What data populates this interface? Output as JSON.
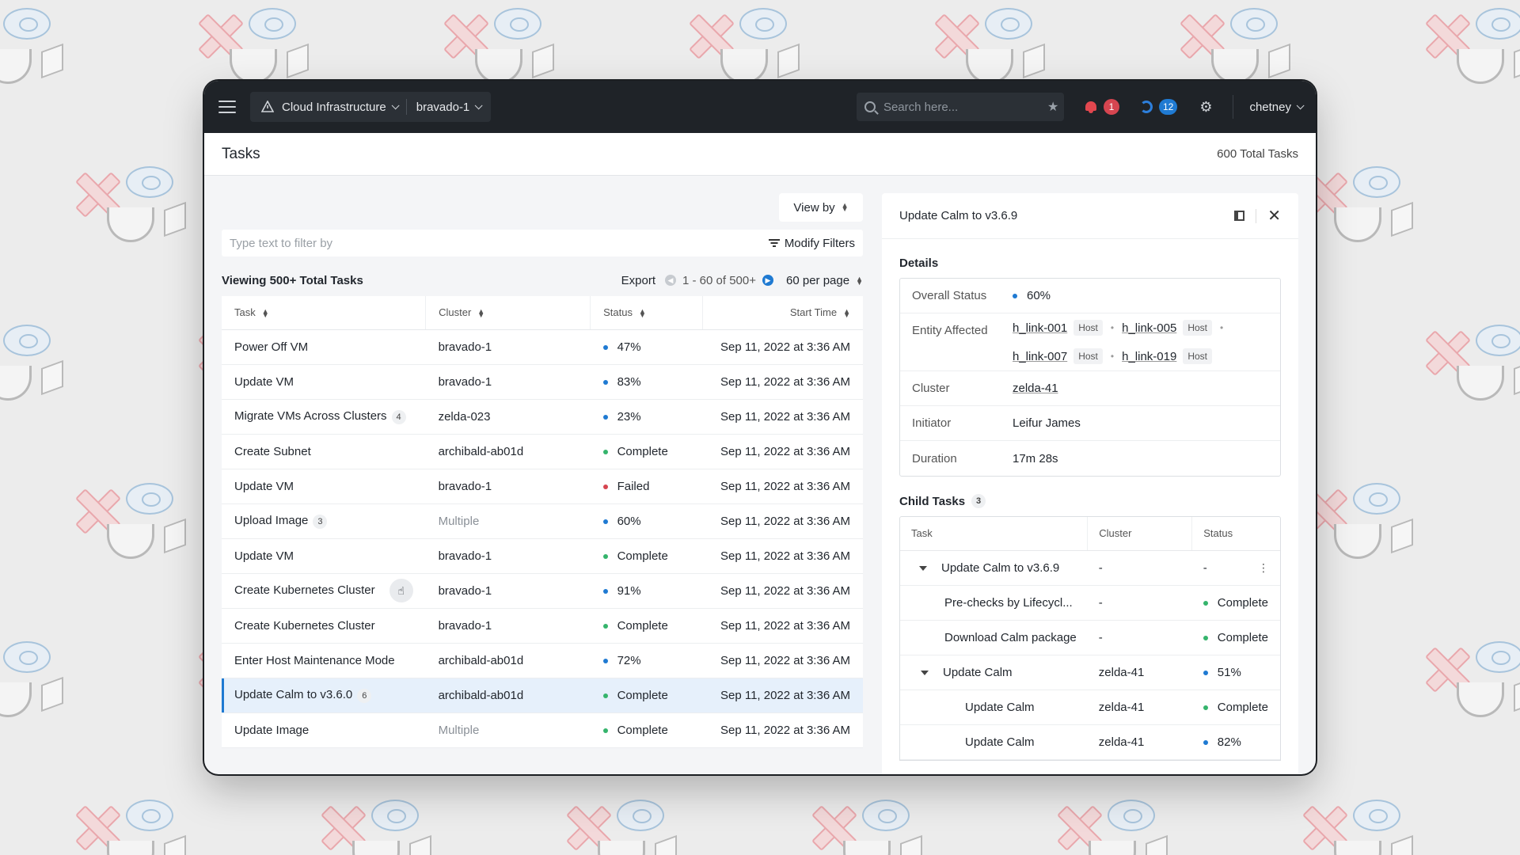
{
  "topbar": {
    "cluster_group": "Cloud Infrastructure",
    "cluster": "bravado-1",
    "search_placeholder": "Search here...",
    "alerts_count": "1",
    "tasks_count": "12",
    "user": "chetney"
  },
  "page": {
    "title": "Tasks",
    "total": "600 Total Tasks"
  },
  "list": {
    "view_by": "View by",
    "filter_placeholder": "Type text to filter by",
    "modify_filters": "Modify Filters",
    "viewing": "Viewing 500+ Total Tasks",
    "export": "Export",
    "range": "1 - 60 of 500+",
    "per_page": "60 per page",
    "columns": [
      "Task",
      "Cluster",
      "Status",
      "Start Time"
    ],
    "rows": [
      {
        "task": "Power Off VM",
        "count": "",
        "cluster": "bravado-1",
        "status": "47%",
        "color": "#1f7ad2",
        "time": "Sep 11, 2022 at 3:36 AM"
      },
      {
        "task": "Update VM",
        "count": "",
        "cluster": "bravado-1",
        "status": "83%",
        "color": "#1f7ad2",
        "time": "Sep 11, 2022 at 3:36 AM"
      },
      {
        "task": "Migrate VMs Across Clusters",
        "count": "4",
        "cluster": "zelda-023",
        "status": "23%",
        "color": "#1f7ad2",
        "time": "Sep 11, 2022 at 3:36 AM"
      },
      {
        "task": "Create Subnet",
        "count": "",
        "cluster": "archibald-ab01d",
        "status": "Complete",
        "color": "#35b46c",
        "time": "Sep 11, 2022 at 3:36 AM"
      },
      {
        "task": "Update VM",
        "count": "",
        "cluster": "bravado-1",
        "status": "Failed",
        "color": "#d64550",
        "time": "Sep 11, 2022 at 3:36 AM"
      },
      {
        "task": "Upload Image",
        "count": "3",
        "cluster": "Multiple",
        "status": "60%",
        "color": "#1f7ad2",
        "time": "Sep 11, 2022 at 3:36 AM"
      },
      {
        "task": "Update VM",
        "count": "",
        "cluster": "bravado-1",
        "status": "Complete",
        "color": "#35b46c",
        "time": "Sep 11, 2022 at 3:36 AM"
      },
      {
        "task": "Create Kubernetes Cluster",
        "count": "",
        "cluster": "bravado-1",
        "status": "91%",
        "color": "#1f7ad2",
        "time": "Sep 11, 2022 at 3:36 AM"
      },
      {
        "task": "Create Kubernetes Cluster",
        "count": "",
        "cluster": "bravado-1",
        "status": "Complete",
        "color": "#35b46c",
        "time": "Sep 11, 2022 at 3:36 AM"
      },
      {
        "task": "Enter Host Maintenance Mode",
        "count": "",
        "cluster": "archibald-ab01d",
        "status": "72%",
        "color": "#1f7ad2",
        "time": "Sep 11, 2022 at 3:36 AM"
      },
      {
        "task": "Update Calm to v3.6.0",
        "count": "6",
        "cluster": "archibald-ab01d",
        "status": "Complete",
        "color": "#35b46c",
        "time": "Sep 11, 2022 at 3:36 AM"
      },
      {
        "task": "Update Image",
        "count": "",
        "cluster": "Multiple",
        "status": "Complete",
        "color": "#35b46c",
        "time": "Sep 11, 2022 at 3:36 AM"
      }
    ]
  },
  "panel": {
    "title": "Update Calm to v3.6.9",
    "details_title": "Details",
    "overall_status_label": "Overall Status",
    "overall_status": "60%",
    "entity_label": "Entity Affected",
    "entities": [
      {
        "name": "h_link-001",
        "tag": "Host"
      },
      {
        "name": "h_link-005",
        "tag": "Host"
      },
      {
        "name": "h_link-007",
        "tag": "Host"
      },
      {
        "name": "h_link-019",
        "tag": "Host"
      }
    ],
    "cluster_label": "Cluster",
    "cluster": "zelda-41",
    "initiator_label": "Initiator",
    "initiator": "Leifur James",
    "duration_label": "Duration",
    "duration": "17m 28s",
    "child_title": "Child Tasks",
    "child_count": "3",
    "child_columns": [
      "Task",
      "Cluster",
      "Status"
    ],
    "child_rows": [
      {
        "task": "Update Calm to v3.6.9",
        "cluster": "-",
        "status": "-",
        "color": ""
      },
      {
        "task": "Pre-checks by Lifecycl...",
        "cluster": "-",
        "status": "Complete",
        "color": "#35b46c"
      },
      {
        "task": "Download Calm package",
        "cluster": "-",
        "status": "Complete",
        "color": "#35b46c"
      },
      {
        "task": "Update Calm",
        "cluster": "zelda-41",
        "status": "51%",
        "color": "#1f7ad2"
      },
      {
        "task": "Update Calm",
        "cluster": "zelda-41",
        "status": "Complete",
        "color": "#35b46c"
      },
      {
        "task": "Update Calm",
        "cluster": "zelda-41",
        "status": "82%",
        "color": "#1f7ad2"
      }
    ]
  }
}
